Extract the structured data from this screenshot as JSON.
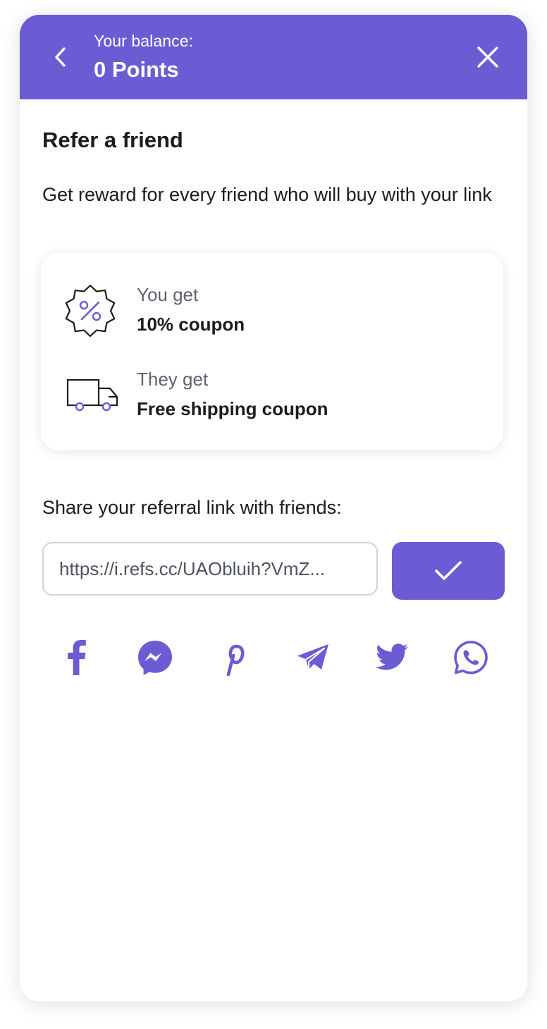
{
  "colors": {
    "accent": "#6b5cd3",
    "text": "#1c1c1e",
    "muted": "#5e6370"
  },
  "header": {
    "balance_label": "Your balance:",
    "balance_value": "0 Points",
    "back_icon": "chevron-left-icon",
    "close_icon": "close-icon"
  },
  "main": {
    "title": "Refer a friend",
    "description": "Get reward for every friend who will buy with your link"
  },
  "rewards": [
    {
      "icon": "discount-badge-icon",
      "label": "You get",
      "value": "10% coupon"
    },
    {
      "icon": "truck-icon",
      "label": "They get",
      "value": "Free shipping coupon"
    }
  ],
  "share": {
    "label": "Share your referral link with friends:",
    "link": "https://i.refs.cc/UAObluih?VmZ...",
    "copy_icon": "check-icon"
  },
  "social_networks": [
    {
      "name": "facebook",
      "icon": "facebook-icon"
    },
    {
      "name": "messenger",
      "icon": "messenger-icon"
    },
    {
      "name": "pinterest",
      "icon": "pinterest-icon"
    },
    {
      "name": "telegram",
      "icon": "telegram-icon"
    },
    {
      "name": "twitter",
      "icon": "twitter-icon"
    },
    {
      "name": "whatsapp",
      "icon": "whatsapp-icon"
    }
  ]
}
